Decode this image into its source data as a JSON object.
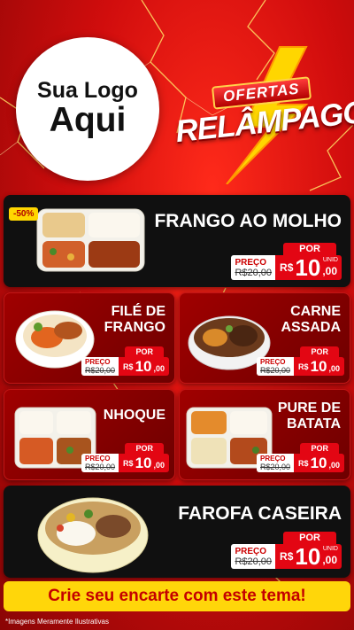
{
  "logo": {
    "line1": "Sua Logo",
    "line2": "Aqui"
  },
  "badge": {
    "tag": "OFERTAS",
    "title": "RELÂMPAGO"
  },
  "products": {
    "frango": {
      "title": "FRANGO AO MOLHO",
      "discount": "-50%",
      "por": "POR",
      "preco_label": "PREÇO",
      "old": "R$20,00",
      "currency": "R$",
      "value": "10",
      "decimals": ",00",
      "unit": "UNID"
    },
    "file": {
      "title_line1": "FILÉ DE",
      "title_line2": "FRANGO",
      "por": "POR",
      "preco_label": "PREÇO",
      "old": "R$20,00",
      "currency": "R$",
      "value": "10",
      "decimals": ",00",
      "unit": "UNID"
    },
    "carne": {
      "title_line1": "CARNE",
      "title_line2": "ASSADA",
      "por": "POR",
      "preco_label": "PREÇO",
      "old": "R$20,00",
      "currency": "R$",
      "value": "10",
      "decimals": ",00",
      "unit": "UNID"
    },
    "nhoque": {
      "title": "NHOQUE",
      "por": "POR",
      "preco_label": "PREÇO",
      "old": "R$20,00",
      "currency": "R$",
      "value": "10",
      "decimals": ",00",
      "unit": "UNID"
    },
    "pure": {
      "title_line1": "PURE DE",
      "title_line2": "BATATA",
      "por": "POR",
      "preco_label": "PREÇO",
      "old": "R$20,00",
      "currency": "R$",
      "value": "10",
      "decimals": ",00",
      "unit": "UNID"
    },
    "farofa": {
      "title": "FAROFA CASEIRA",
      "por": "POR",
      "preco_label": "PREÇO",
      "old": "R$20,00",
      "currency": "R$",
      "value": "10",
      "decimals": ",00",
      "unit": "UNID"
    }
  },
  "cta": "Crie seu encarte com este tema!",
  "footnote": "*Imagens Meramente Ilustrativas",
  "colors": {
    "background": "#d10d0d",
    "accent_yellow": "#ffd60a",
    "price_red": "#e30613",
    "card_black": "#101010"
  }
}
